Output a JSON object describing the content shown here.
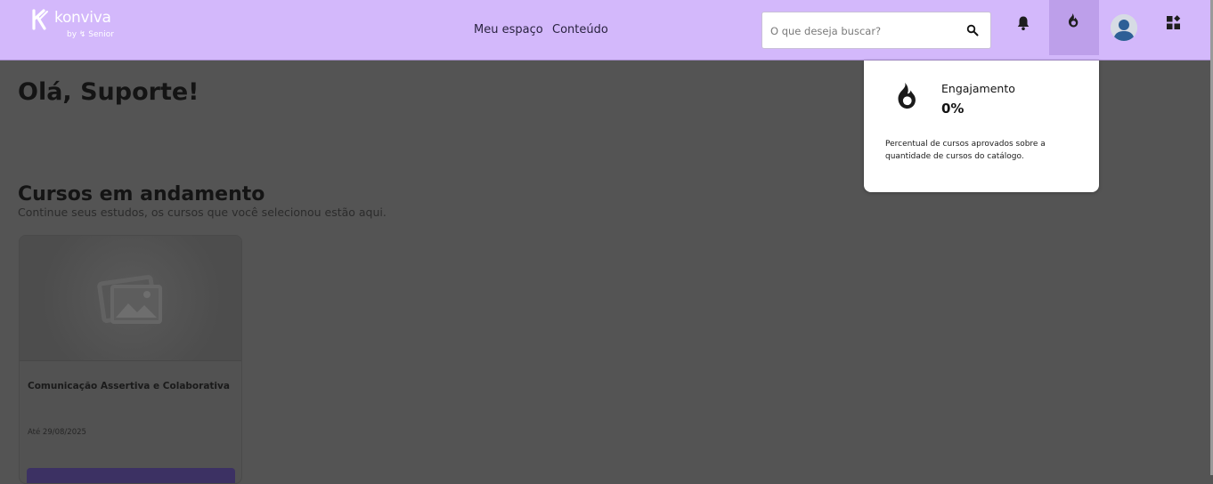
{
  "header": {
    "logo_name": "konviva",
    "logo_sub": "by ↯ Senior",
    "nav": [
      "Meu espaço",
      "Conteúdo"
    ],
    "search_placeholder": "O que deseja buscar?"
  },
  "main": {
    "greeting": "Olá, Suporte!",
    "section_title": "Cursos em andamento",
    "section_subtitle": "Continue seus estudos, os cursos que você selecionou estão aqui."
  },
  "courses": [
    {
      "title": "Comunicação Assertiva e Colaborativa",
      "date": "Até 29/08/2025"
    }
  ],
  "engagement": {
    "title": "Engajamento",
    "value": "0%",
    "description": "Percentual de cursos aprovados sobre a quantidade de cursos do catálogo."
  },
  "colors": {
    "header_bg": "#d3b8fb",
    "header_active": "#bd9fea",
    "overlay_bg": "#545454",
    "card_button": "#3c3163"
  },
  "icons": [
    "konviva-logo-icon",
    "search-icon",
    "bell-icon",
    "flame-icon",
    "avatar-icon",
    "apps-grid-icon",
    "image-placeholder-icon"
  ]
}
